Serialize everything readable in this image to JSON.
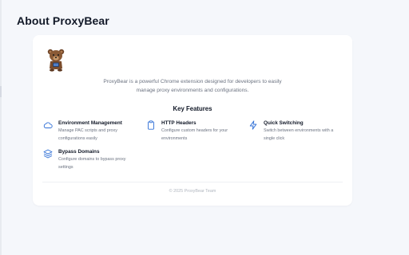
{
  "page": {
    "title": "About ProxyBear"
  },
  "about": {
    "logo_icon": "bear-logo-icon",
    "description": "ProxyBear is a powerful Chrome extension designed for developers to easily manage proxy environments and configurations.",
    "features_heading": "Key Features",
    "accent_color": "#2f6fd6",
    "features": [
      {
        "icon": "cloud-icon",
        "title": "Environment Management",
        "description": "Manage PAC scripts and proxy configurations easily"
      },
      {
        "icon": "clipboard-icon",
        "title": "HTTP Headers",
        "description": "Configure custom headers for your environments"
      },
      {
        "icon": "lightning-icon",
        "title": "Quick Switching",
        "description": "Switch between environments with a single click"
      },
      {
        "icon": "layers-icon",
        "title": "Bypass Domains",
        "description": "Configure domains to bypass proxy settings"
      }
    ],
    "footer": "© 2025 ProxyBear Team"
  }
}
